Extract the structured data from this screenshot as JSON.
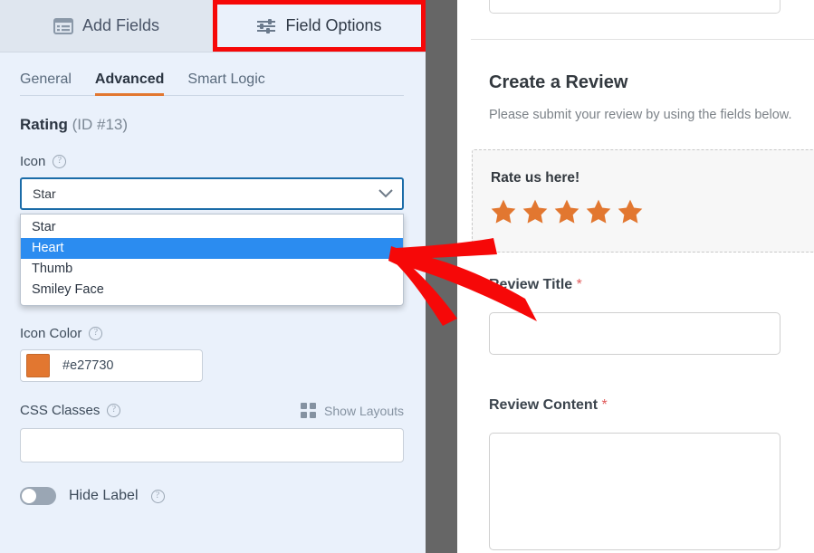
{
  "builder": {
    "top_tabs": [
      {
        "label": "Add Fields",
        "icon": "list-panel-icon",
        "active": false
      },
      {
        "label": "Field Options",
        "icon": "sliders-icon",
        "active": true
      }
    ],
    "sub_tabs": [
      {
        "label": "General",
        "active": false
      },
      {
        "label": "Advanced",
        "active": true
      },
      {
        "label": "Smart Logic",
        "active": false
      }
    ],
    "field_title": {
      "name": "Rating",
      "id_text": "(ID #13)"
    },
    "icon_setting": {
      "label": "Icon",
      "selected": "Star",
      "options": [
        "Star",
        "Heart",
        "Thumb",
        "Smiley Face"
      ],
      "highlighted_option": "Heart"
    },
    "icon_color": {
      "label": "Icon Color",
      "value": "#e27730",
      "swatch_hex": "#e27730"
    },
    "css_classes": {
      "label": "CSS Classes",
      "value": "",
      "show_layouts_label": "Show Layouts"
    },
    "hide_label": {
      "label": "Hide Label",
      "enabled": false
    }
  },
  "preview": {
    "title": "Create a Review",
    "subtitle": "Please submit your review by using the fields below.",
    "rating_field": {
      "label": "Rate us here!",
      "star_count": 5,
      "star_color": "#e27730"
    },
    "fields": [
      {
        "label": "Review Title",
        "required_mark": "*",
        "value": ""
      },
      {
        "label": "Review Content",
        "required_mark": "*",
        "value": ""
      }
    ]
  },
  "annotation": {
    "highlight_color": "#f60808",
    "arrow_color": "#f60808"
  }
}
